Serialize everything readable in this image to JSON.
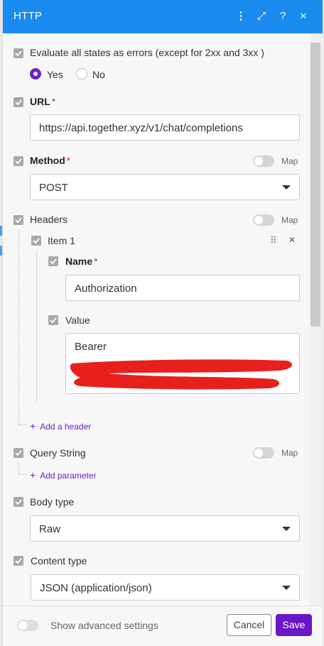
{
  "header": {
    "title": "HTTP",
    "icons": [
      "more-vertical-icon",
      "expand-icon",
      "help-icon",
      "close-icon"
    ],
    "menu_glyph": "⋮",
    "expand_glyph": "⤢",
    "help_glyph": "?",
    "close_glyph": "✕"
  },
  "evaluate": {
    "label": "Evaluate all states as errors (except for 2xx and 3xx )",
    "options": [
      "Yes",
      "No"
    ],
    "selected": "Yes"
  },
  "url": {
    "label": "URL",
    "required_mark": "*",
    "value": "https://api.together.xyz/v1/chat/completions"
  },
  "method": {
    "label": "Method",
    "required_mark": "*",
    "map_label": "Map",
    "value": "POST"
  },
  "headers": {
    "label": "Headers",
    "map_label": "Map",
    "item_label": "Item 1",
    "drag_glyph": "⠿",
    "remove_glyph": "✕",
    "name_label": "Name",
    "name_required_mark": "*",
    "name_value": "Authorization",
    "value_label": "Value",
    "value_text": "Bearer",
    "add_label": "Add a header"
  },
  "query": {
    "label": "Query String",
    "map_label": "Map",
    "add_label": "Add parameter"
  },
  "body_type": {
    "label": "Body type",
    "value": "Raw"
  },
  "content_type": {
    "label": "Content type",
    "value": "JSON (application/json)"
  },
  "footer": {
    "advanced_label": "Show advanced settings",
    "cancel_label": "Cancel",
    "save_label": "Save"
  },
  "colors": {
    "header_bg": "#1a8cf0",
    "accent": "#6a16c8",
    "redaction": "#e8201c"
  }
}
